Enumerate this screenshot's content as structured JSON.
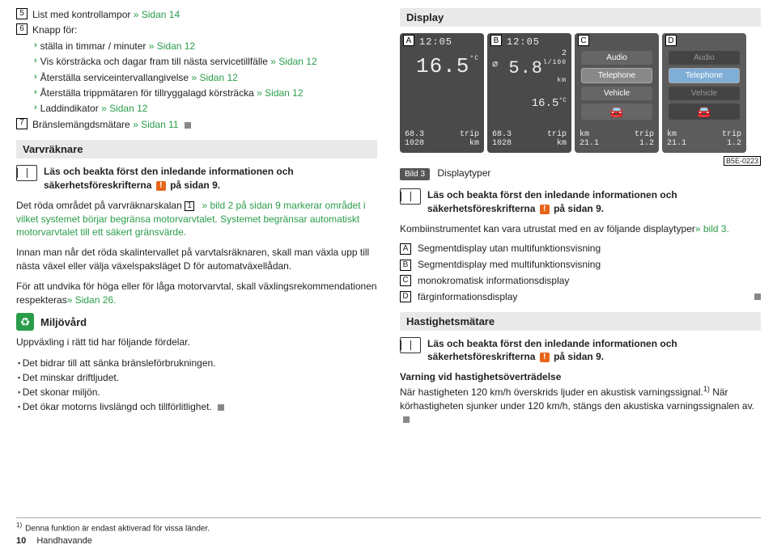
{
  "left": {
    "item5": {
      "num": "5",
      "text": "List med kontrollampor",
      "link": "» Sidan 14"
    },
    "item6": {
      "num": "6",
      "text": "Knapp för:"
    },
    "sub": [
      {
        "text": "ställa in timmar / minuter",
        "link": "» Sidan 12"
      },
      {
        "text": "Vis körsträcka och dagar fram till nästa servicetillfälle",
        "link": "» Sidan 12"
      },
      {
        "text": "Återställa serviceintervallangivelse",
        "link": "» Sidan 12"
      },
      {
        "text": "Återställa trippmätaren för tillryggalagd körsträcka",
        "link": "» Sidan 12"
      },
      {
        "text": "Laddindikator",
        "link": "» Sidan 12"
      }
    ],
    "item7": {
      "num": "7",
      "text": "Bränslemängdsmätare",
      "link": "» Sidan 11"
    },
    "sec_varv": "Varvräknare",
    "safety": "Läs och beakta först den inledande informationen och säkerhetsföreskrifterna ",
    "safety_tail": " på sidan 9.",
    "p1a": "Det röda området på varvräknarskalan ",
    "p1b": " » bild 2 på sidan 9 markerar området i vilket systemet börjar begränsa motorvarvtalet. Systemet begränsar automatiskt motorvarvtalet till ett säkert gränsvärde.",
    "p1box": "1",
    "p2": "Innan man når det röda skalintervallet på varvtalsräknaren, skall man växla upp till nästa växel eller välja växelspaksläget D för automatväxellådan.",
    "p3a": "För att undvika för höga eller för låga motorvarvtal, skall växlingsrekommendationen respekteras",
    "p3b": "» Sidan 26.",
    "eco_head": "Miljövård",
    "eco_intro": "Uppväxling i rätt tid har följande fördelar.",
    "eco_bul": [
      "Det bidrar till att sänka bränsleförbrukningen.",
      "Det minskar driftljudet.",
      "Det skonar miljön.",
      "Det ökar motorns livslängd och tillförlitlighet."
    ]
  },
  "right": {
    "sec_display": "Display",
    "panels": {
      "A": {
        "time": "12:05",
        "big": "16.5",
        "unit": "°C",
        "l1a": "68.3",
        "l1b": "trip",
        "l2a": "1028",
        "l2b": "km"
      },
      "B": {
        "time": "12:05",
        "gear": "2",
        "avg": "⌀",
        "big": "5.8",
        "unit": "l/100 km",
        "mid": "16.5",
        "midu": "°C",
        "l1a": "68.3",
        "l1b": "trip",
        "l2a": "1028",
        "l2b": "km"
      },
      "C": {
        "m1": "Audio",
        "m2": "Telephone",
        "m3": "Vehicle",
        "sym": "🚘",
        "b1": "km",
        "b2": "trip",
        "b3": "21.1",
        "b4": "1.2"
      },
      "D": {
        "m1": "Audio",
        "m2": "Telephone",
        "m3": "Vehicle",
        "b1": "km",
        "b2": "trip",
        "b3": "21.1",
        "b4": "1.2"
      }
    },
    "figcode": "B5E-0223",
    "bild": "Bild 3",
    "bild_txt": "Displaytyper",
    "kombi_a": "Kombiinstrumentet kan vara utrustat med en av följande displaytyper",
    "kombi_b": "» bild 3.",
    "types": [
      {
        "l": "A",
        "t": "Segmentdisplay utan multifunktionsvisning"
      },
      {
        "l": "B",
        "t": "Segmentdisplay med multifunktionsvisning"
      },
      {
        "l": "C",
        "t": "monokromatisk informationsdisplay"
      },
      {
        "l": "D",
        "t": "färginformationsdisplay"
      }
    ],
    "sec_hast": "Hastighetsmätare",
    "h_head": "Varning vid hastighetsöverträdelse",
    "h_body_a": "När hastigheten 120 km/h överskrids ljuder en akustisk varningssignal.",
    "h_body_b": " När körhastigheten sjunker under 120 km/h, stängs den akustiska varningssignalen av.",
    "fnmark": "1)"
  },
  "foot": {
    "fn": "Denna funktion är endast aktiverad för vissa länder.",
    "pn": "10",
    "sec": "Handhavande"
  }
}
